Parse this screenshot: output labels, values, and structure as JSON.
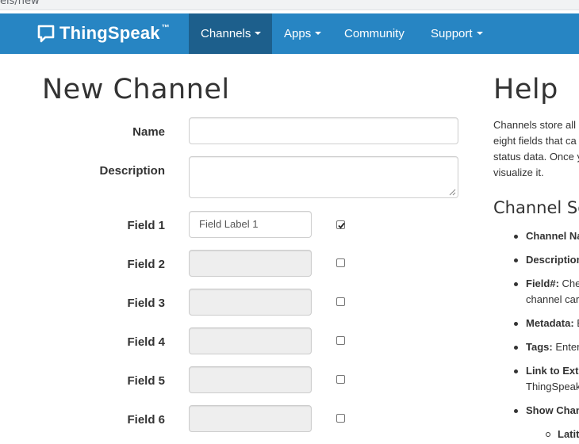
{
  "browser": {
    "url_fragment": "els/new"
  },
  "navbar": {
    "brand": "ThingSpeak",
    "brand_tm": "™",
    "items": [
      {
        "label": "Channels",
        "dropdown": true,
        "active": true
      },
      {
        "label": "Apps",
        "dropdown": true,
        "active": false
      },
      {
        "label": "Community",
        "dropdown": false,
        "active": false
      },
      {
        "label": "Support",
        "dropdown": true,
        "active": false
      }
    ],
    "colors": {
      "bar": "#2785c3",
      "active": "#1d5f8c"
    }
  },
  "form": {
    "title": "New Channel",
    "name_label": "Name",
    "name_value": "",
    "description_label": "Description",
    "description_value": "",
    "fields": [
      {
        "label": "Field 1",
        "value": "Field Label 1",
        "enabled": true,
        "checked": true
      },
      {
        "label": "Field 2",
        "value": "",
        "enabled": false,
        "checked": false
      },
      {
        "label": "Field 3",
        "value": "",
        "enabled": false,
        "checked": false
      },
      {
        "label": "Field 4",
        "value": "",
        "enabled": false,
        "checked": false
      },
      {
        "label": "Field 5",
        "value": "",
        "enabled": false,
        "checked": false
      },
      {
        "label": "Field 6",
        "value": "",
        "enabled": false,
        "checked": false
      }
    ]
  },
  "help": {
    "title": "Help",
    "intro_lines": [
      "Channels store all",
      "eight fields that ca",
      "status data. Once y",
      "visualize it."
    ],
    "section_title": "Channel Se",
    "items": [
      {
        "bold": "Channel Na",
        "rest": ""
      },
      {
        "bold": "Description",
        "rest": ""
      },
      {
        "bold": "Field#:",
        "rest": " Chec",
        "line2": "channel car"
      },
      {
        "bold": "Metadata:",
        "rest": " E"
      },
      {
        "bold": "Tags:",
        "rest": " Enter"
      },
      {
        "bold": "Link to Exte",
        "rest": "",
        "line2": "ThingSpeak"
      },
      {
        "bold": "Show Chan",
        "rest": ""
      }
    ],
    "subitem": "Latit"
  }
}
